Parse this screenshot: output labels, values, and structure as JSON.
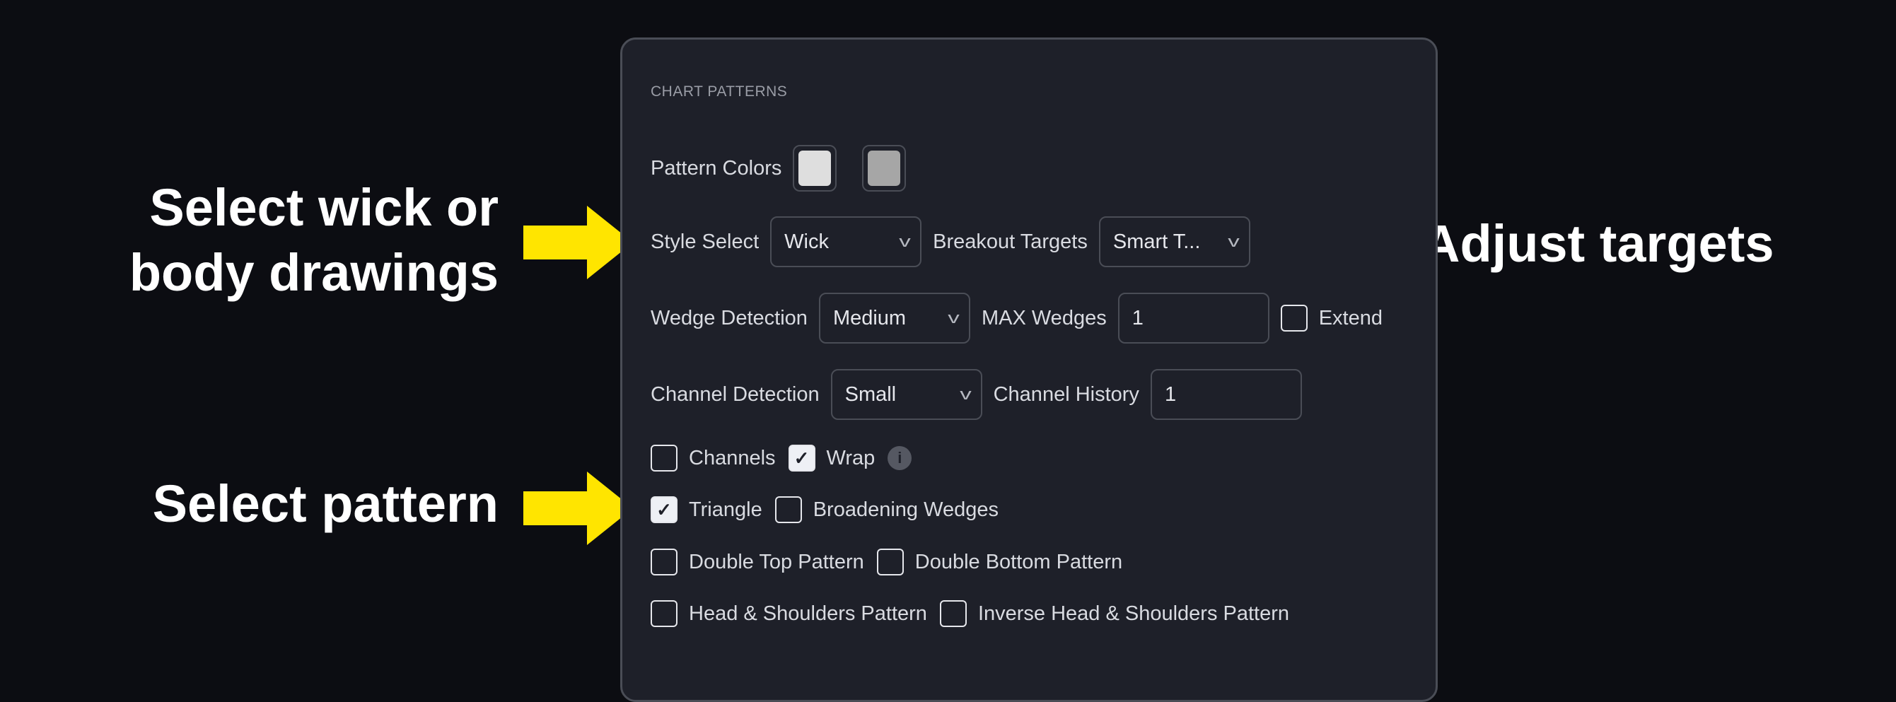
{
  "panel": {
    "title": "CHART PATTERNS",
    "pattern_colors": {
      "label": "Pattern Colors",
      "colors": [
        "#dedede",
        "#a6a6a6"
      ]
    },
    "style_select": {
      "label": "Style Select",
      "value": "Wick"
    },
    "breakout_targets": {
      "label": "Breakout Targets",
      "value": "Smart T..."
    },
    "wedge_detection": {
      "label": "Wedge Detection",
      "value": "Medium"
    },
    "max_wedges": {
      "label": "MAX Wedges",
      "value": "1"
    },
    "extend": {
      "label": "Extend",
      "checked": false
    },
    "channel_detection": {
      "label": "Channel Detection",
      "value": "Small"
    },
    "channel_history": {
      "label": "Channel History",
      "value": "1"
    },
    "checkboxes": [
      {
        "label": "Channels",
        "checked": false
      },
      {
        "label": "Wrap",
        "checked": true
      },
      {
        "label": "Triangle",
        "checked": true
      },
      {
        "label": "Broadening Wedges",
        "checked": false
      },
      {
        "label": "Double Top Pattern",
        "checked": false
      },
      {
        "label": "Double Bottom Pattern",
        "checked": false
      },
      {
        "label": "Head & Shoulders Pattern",
        "checked": false
      },
      {
        "label": "Inverse Head & Shoulders Pattern",
        "checked": false
      }
    ],
    "icons": {
      "info": "info-icon",
      "chevron": "chevron-down-icon",
      "check": "checkmark-icon"
    }
  },
  "annotations": {
    "style_line1": "Select wick or",
    "style_line2": "body drawings",
    "targets": "Adjust targets",
    "pattern": "Select pattern",
    "arrow_color": "#ffe500"
  }
}
